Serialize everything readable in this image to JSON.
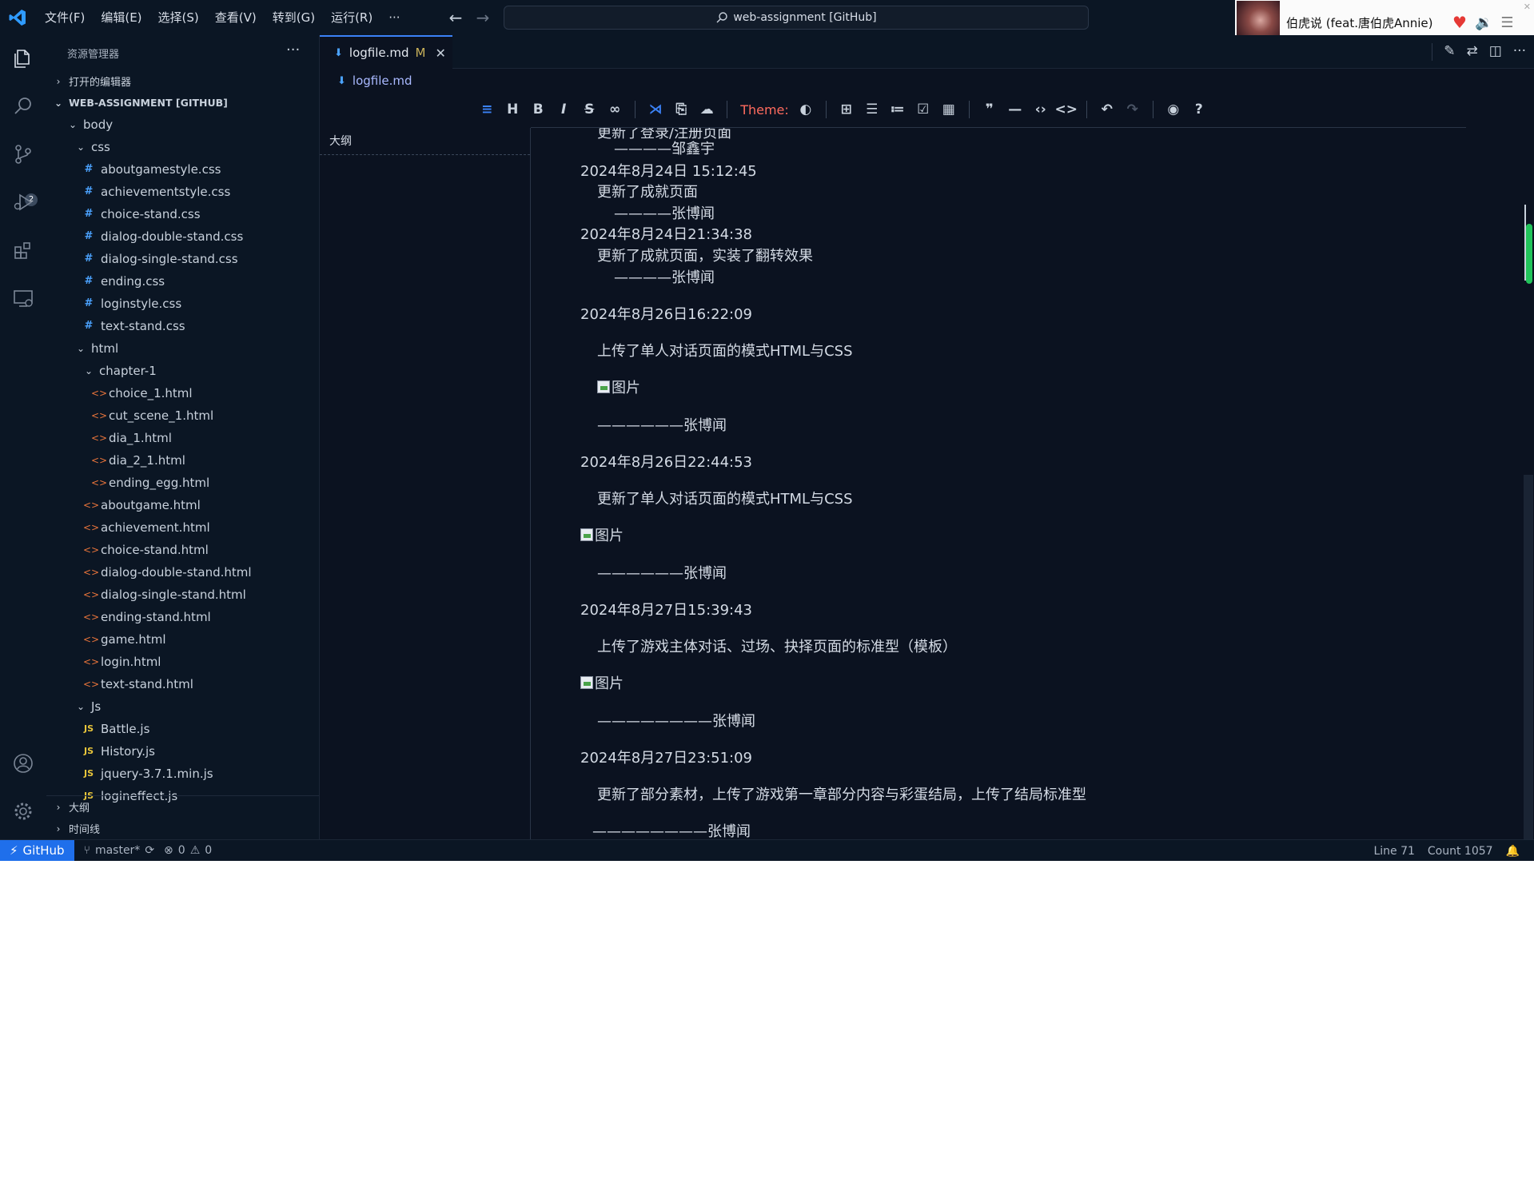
{
  "titlebar": {
    "menu": [
      "文件(F)",
      "编辑(E)",
      "选择(S)",
      "查看(V)",
      "转到(G)",
      "运行(R)",
      "···"
    ],
    "search": "web-assignment [GitHub]"
  },
  "music": {
    "song": "伯虎说 (feat.唐伯虎Annie)"
  },
  "activity": {
    "scm_badge": "2"
  },
  "sidebar": {
    "title": "资源管理器",
    "more": "···",
    "open_editors": "打开的编辑器",
    "root": "WEB-ASSIGNMENT [GITHUB]",
    "items": [
      {
        "label": "body",
        "type": "folder"
      },
      {
        "label": "css",
        "type": "folder"
      },
      {
        "label": "aboutgamestyle.css",
        "type": "css"
      },
      {
        "label": "achievementstyle.css",
        "type": "css"
      },
      {
        "label": "choice-stand.css",
        "type": "css"
      },
      {
        "label": "dialog-double-stand.css",
        "type": "css"
      },
      {
        "label": "dialog-single-stand.css",
        "type": "css"
      },
      {
        "label": "ending.css",
        "type": "css"
      },
      {
        "label": "loginstyle.css",
        "type": "css"
      },
      {
        "label": "text-stand.css",
        "type": "css"
      },
      {
        "label": "html",
        "type": "folder"
      },
      {
        "label": "chapter-1",
        "type": "folder"
      },
      {
        "label": "choice_1.html",
        "type": "html"
      },
      {
        "label": "cut_scene_1.html",
        "type": "html"
      },
      {
        "label": "dia_1.html",
        "type": "html"
      },
      {
        "label": "dia_2_1.html",
        "type": "html"
      },
      {
        "label": "ending_egg.html",
        "type": "html"
      },
      {
        "label": "aboutgame.html",
        "type": "html"
      },
      {
        "label": "achievement.html",
        "type": "html"
      },
      {
        "label": "choice-stand.html",
        "type": "html"
      },
      {
        "label": "dialog-double-stand.html",
        "type": "html"
      },
      {
        "label": "dialog-single-stand.html",
        "type": "html"
      },
      {
        "label": "ending-stand.html",
        "type": "html"
      },
      {
        "label": "game.html",
        "type": "html"
      },
      {
        "label": "login.html",
        "type": "html"
      },
      {
        "label": "text-stand.html",
        "type": "html"
      },
      {
        "label": "Js",
        "type": "folder"
      },
      {
        "label": "Battle.js",
        "type": "js"
      },
      {
        "label": "History.js",
        "type": "js"
      },
      {
        "label": "jquery-3.7.1.min.js",
        "type": "js"
      },
      {
        "label": "logineffect.js",
        "type": "js"
      }
    ],
    "outline_section": "大纲",
    "timeline_section": "时间线"
  },
  "editor": {
    "tab_label": "logfile.md",
    "tab_modified": "M",
    "tab_close": "✕",
    "breadcrumb": "logfile.md",
    "toolbar_theme": "Theme:",
    "outline_title": "大纲",
    "content": [
      "更新了登录/注册页面",
      "————邹鑫宇",
      "2024年8月24日 15:12:45",
      "更新了成就页面",
      "————张博闻",
      "2024年8月24日21:34:38",
      "更新了成就页面，实装了翻转效果",
      "————张博闻",
      "2024年8月26日16:22:09",
      "上传了单人对话页面的模式HTML与CSS",
      "图片",
      "——————张博闻",
      "2024年8月26日22:44:53",
      "更新了单人对话页面的模式HTML与CSS",
      "图片",
      "——————张博闻",
      "2024年8月27日15:39:43",
      "上传了游戏主体对话、过场、抉择页面的标准型（模板）",
      "图片",
      "————————张博闻",
      "2024年8月27日23:51:09",
      "更新了部分素材，上传了游戏第一章部分内容与彩蛋结局，上传了结局标准型",
      "————————张博闻"
    ]
  },
  "status": {
    "remote": "GitHub",
    "branch": "master*",
    "errors": "0",
    "warnings": "0",
    "line": "Line 71",
    "count": "Count 1057"
  },
  "colors": {
    "background": "#0b1220",
    "accent": "#3b82f6",
    "theme_label": "#ff6b5e",
    "css_icon": "#4ba3ff",
    "html_icon": "#e8743b",
    "js_icon": "#e8c53b"
  }
}
